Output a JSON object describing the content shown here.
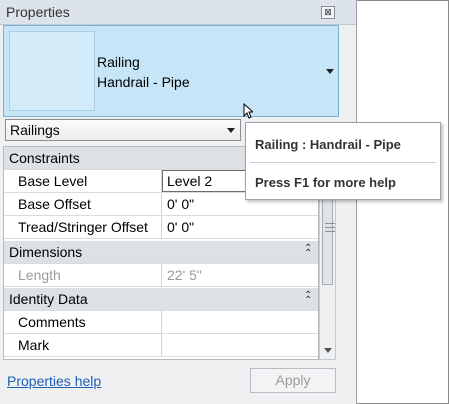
{
  "window": {
    "title": "Properties",
    "close_glyph": "⊠"
  },
  "type_selector": {
    "family": "Railing",
    "type": "Handrail - Pipe"
  },
  "category_filter": {
    "selected": "Railings"
  },
  "grid": {
    "rows": [
      {
        "kind": "section",
        "label": "Constraints"
      },
      {
        "kind": "param",
        "name": "Base Level",
        "value": "Level 2",
        "editing": true
      },
      {
        "kind": "param",
        "name": "Base Offset",
        "value": "0'  0\""
      },
      {
        "kind": "param",
        "name": "Tread/Stringer Offset",
        "value": "0'  0\""
      },
      {
        "kind": "section",
        "label": "Dimensions",
        "collapse_icon": "double-chevron-up-icon"
      },
      {
        "kind": "param",
        "name": "Length",
        "value": "22'  5\"",
        "greyed": true
      },
      {
        "kind": "section",
        "label": "Identity Data",
        "collapse_icon": "double-chevron-up-icon"
      },
      {
        "kind": "param",
        "name": "Comments",
        "value": ""
      },
      {
        "kind": "param",
        "name": "Mark",
        "value": ""
      }
    ]
  },
  "footer": {
    "help_link": "Properties help",
    "apply_label": "Apply"
  },
  "tooltip": {
    "title": "Railing : Handrail - Pipe",
    "help_text": "Press F1 for more help"
  },
  "colors": {
    "selector_bg": "#c6e6f7",
    "link": "#1f5fb3",
    "section_bg": "#dde0e4"
  }
}
